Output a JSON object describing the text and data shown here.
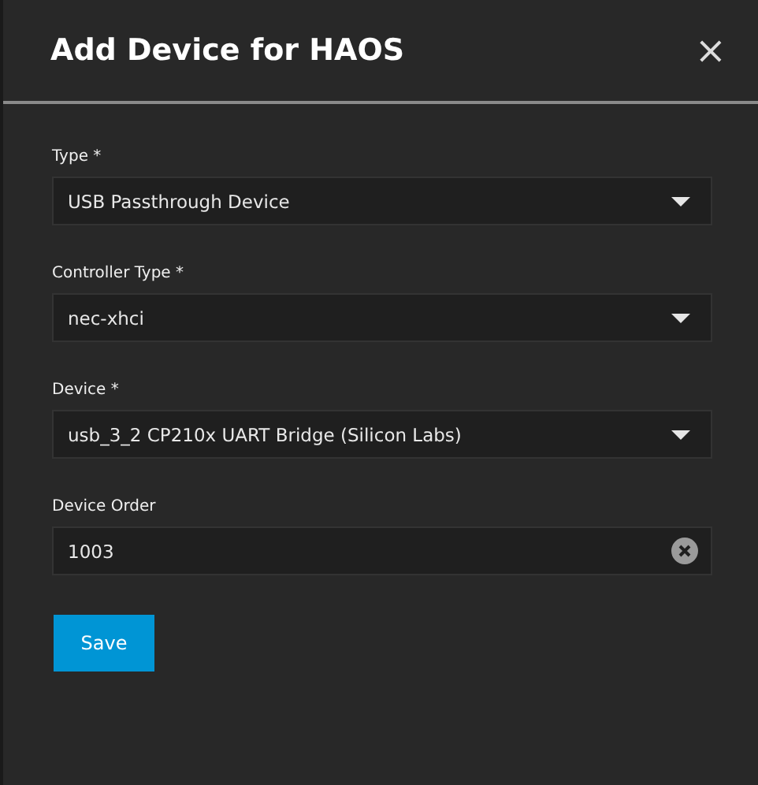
{
  "dialog": {
    "title": "Add Device for HAOS",
    "close": "×"
  },
  "fields": [
    {
      "kind": "select",
      "label": "Type *",
      "value": "USB Passthrough Device"
    },
    {
      "kind": "select",
      "label": "Controller Type *",
      "value": "nec-xhci"
    },
    {
      "kind": "select",
      "label": "Device *",
      "value": "usb_3_2 CP210x UART Bridge (Silicon Labs)"
    },
    {
      "kind": "input",
      "label": "Device Order",
      "value": "1003"
    }
  ],
  "buttons": [
    {
      "label": "Save"
    }
  ]
}
